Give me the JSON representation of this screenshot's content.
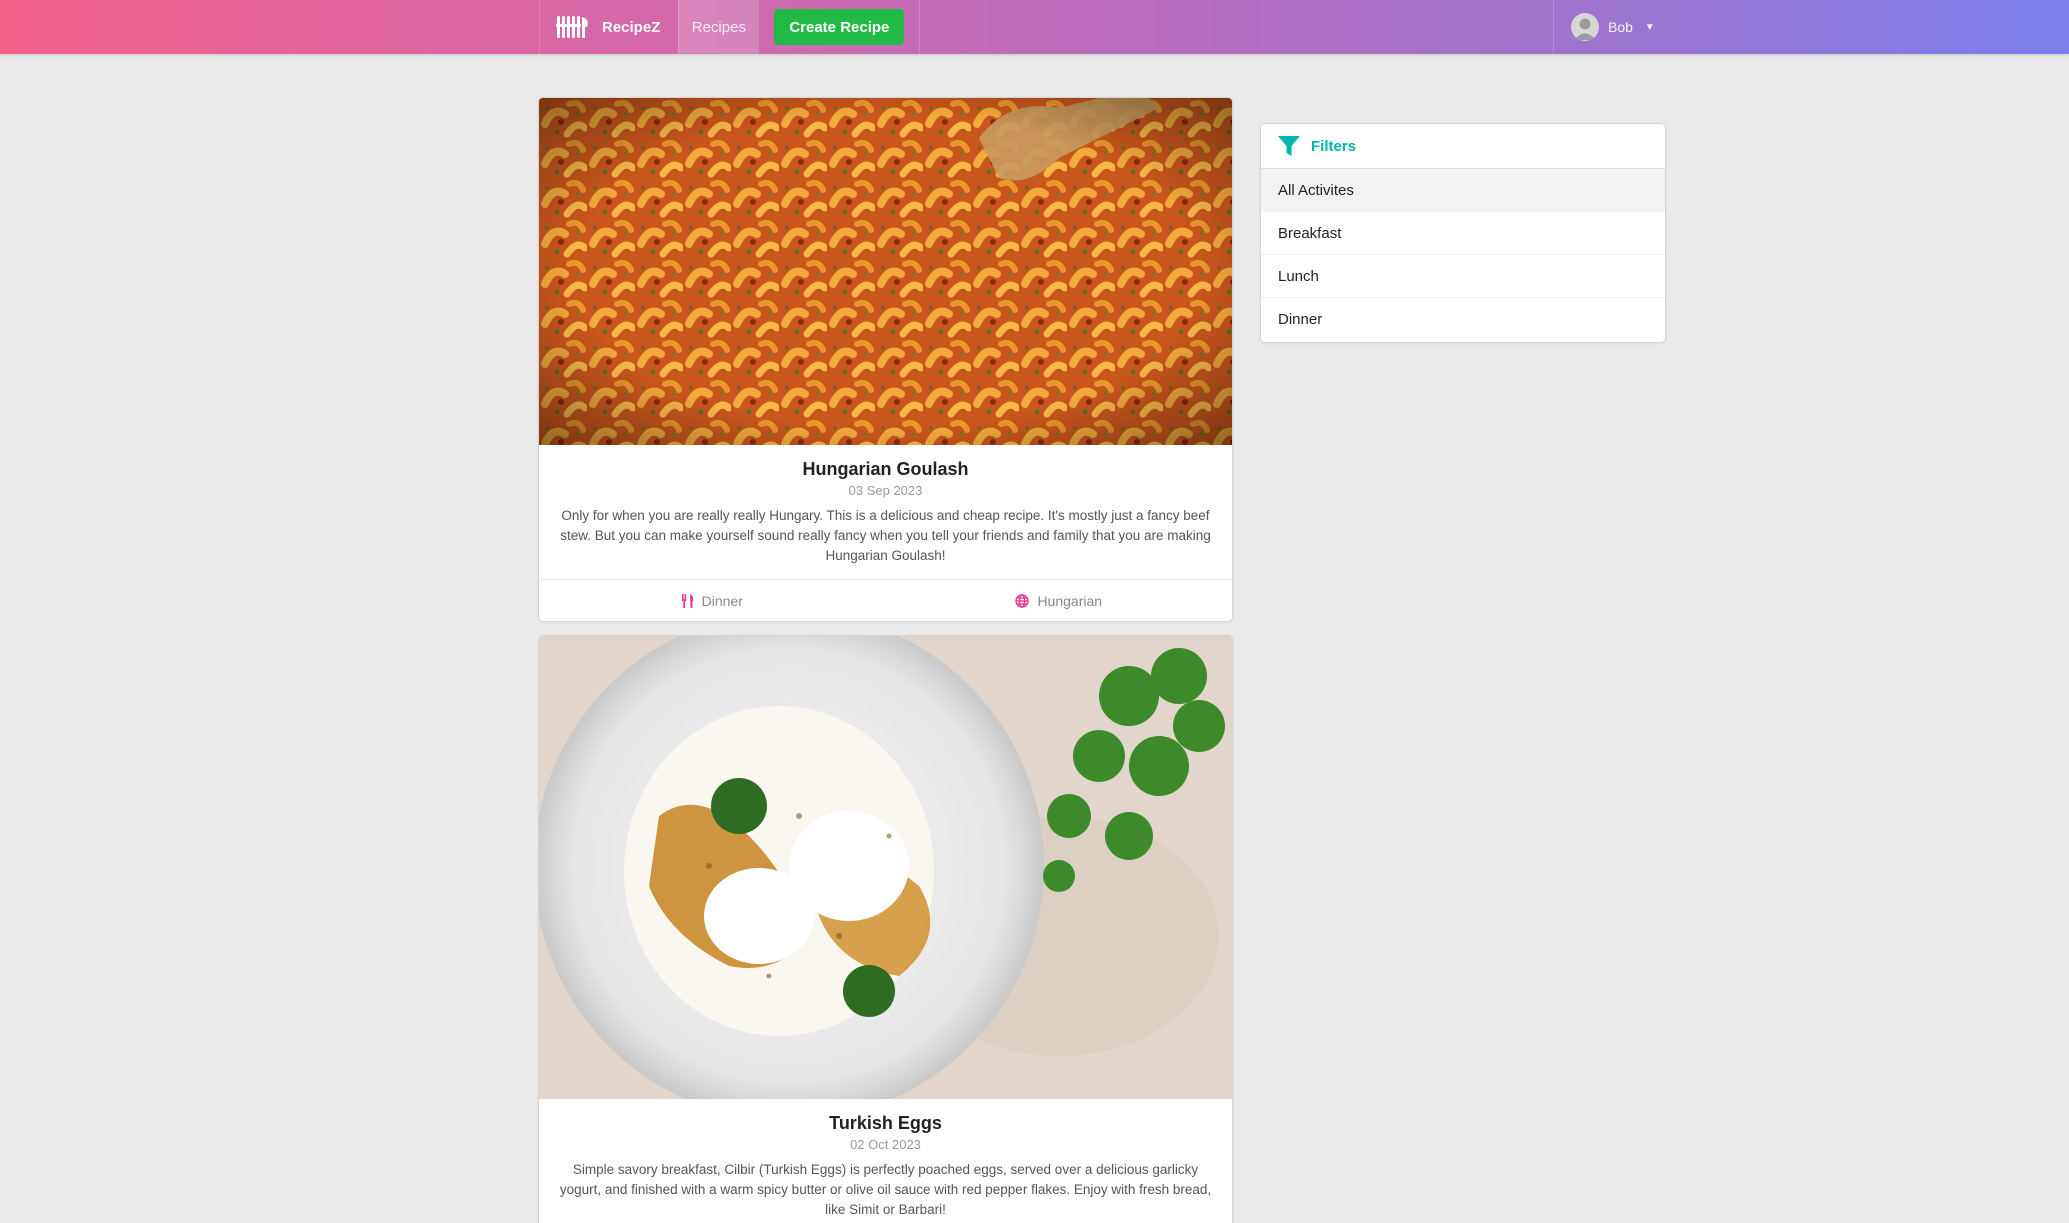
{
  "navbar": {
    "brand": "RecipeZ",
    "recipes_label": "Recipes",
    "create_label": "Create Recipe",
    "user_name": "Bob",
    "gradient": [
      "#f4628c",
      "#7d80ec"
    ]
  },
  "recipes": [
    {
      "title": "Hungarian Goulash",
      "date": "03 Sep 2023",
      "description": "Only for when you are really really Hungary. This is a delicious and cheap recipe. It's mostly just a fancy beef stew. But you can make yourself sound really fancy when you tell your friends and family that you are making Hungarian Goulash!",
      "category": "Dinner",
      "cuisine": "Hungarian"
    },
    {
      "title": "Turkish Eggs",
      "date": "02 Oct 2023",
      "description": "Simple savory breakfast, Cilbir (Turkish Eggs) is perfectly poached eggs, served over a delicious garlicky yogurt, and finished with a warm spicy butter or olive oil sauce with red pepper flakes. Enjoy with fresh bread, like Simit or Barbari!"
    }
  ],
  "filters": {
    "title": "Filters",
    "items": [
      "All Activites",
      "Breakfast",
      "Lunch",
      "Dinner"
    ],
    "active_index": 0,
    "accent": "#00b5ad"
  },
  "icons": {
    "brand": "cutlery-logo-icon",
    "category": "utensils-icon",
    "cuisine": "globe-icon",
    "filter": "filter-icon",
    "user": "user-avatar-icon",
    "dropdown": "caret-down-icon"
  },
  "colors": {
    "create_button": "#21ba45",
    "meta_icon": "#e03997",
    "background": "#eaeaea"
  }
}
